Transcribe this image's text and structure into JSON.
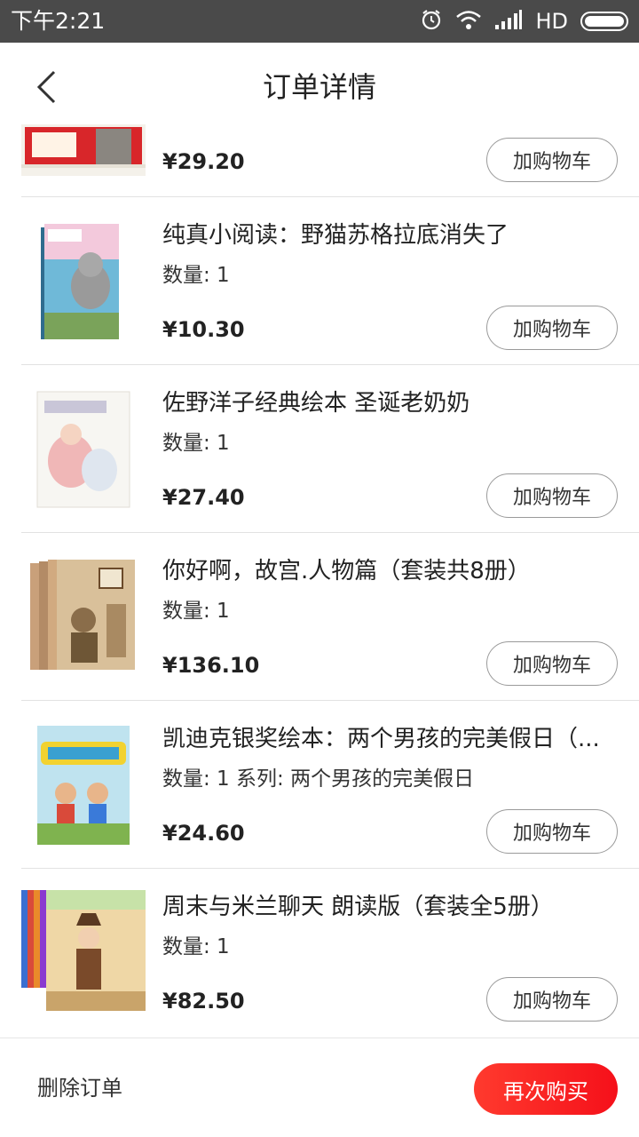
{
  "status_bar": {
    "time": "下午2:21",
    "network": "HD"
  },
  "header": {
    "title": "订单详情"
  },
  "items": [
    {
      "name": "",
      "quantity": "",
      "price": "¥29.20",
      "cart_label": "加购物车"
    },
    {
      "name": "纯真小阅读：野猫苏格拉底消失了",
      "quantity": "数量: 1",
      "price": "¥10.30",
      "cart_label": "加购物车"
    },
    {
      "name": "佐野洋子经典绘本 圣诞老奶奶",
      "quantity": "数量: 1",
      "price": "¥27.40",
      "cart_label": "加购物车"
    },
    {
      "name": "你好啊，故宫.人物篇（套装共8册）",
      "quantity": "数量: 1",
      "price": "¥136.10",
      "cart_label": "加购物车"
    },
    {
      "name": "凯迪克银奖绘本：两个男孩的完美假日（...",
      "quantity": "数量: 1 系列: 两个男孩的完美假日",
      "price": "¥24.60",
      "cart_label": "加购物车"
    },
    {
      "name": "周末与米兰聊天 朗读版（套装全5册）",
      "quantity": "数量: 1",
      "price": "¥82.50",
      "cart_label": "加购物车"
    }
  ],
  "footer": {
    "delete_label": "删除订单",
    "rebuy_label": "再次购买"
  },
  "colors": {
    "accent": "#f5101a",
    "status_bar": "#4a4a4a"
  }
}
